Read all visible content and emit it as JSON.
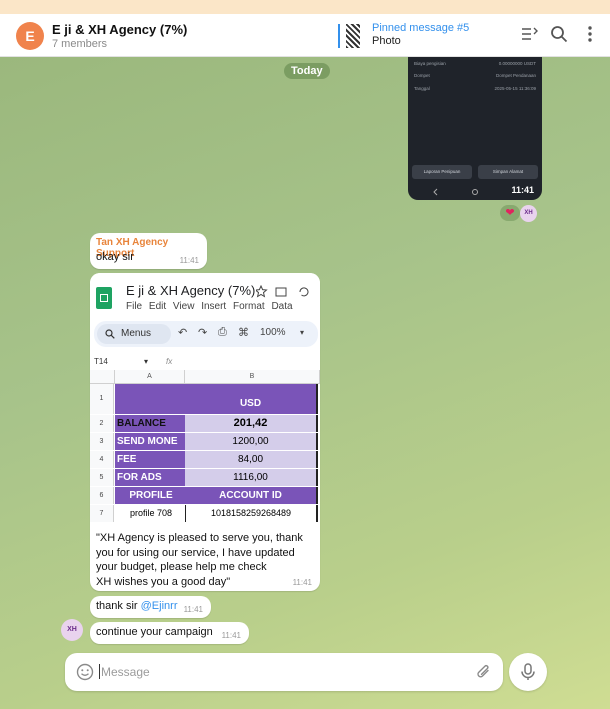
{
  "header": {
    "avatar_letter": "E",
    "title": "E ji & XH Agency (7%)",
    "members": "7 members",
    "pinned_title": "Pinned message #5",
    "pinned_subtitle": "Photo"
  },
  "chat": {
    "date_badge": "Today",
    "phone_screenshot": {
      "rows": [
        {
          "label": "Biaya pengisian",
          "value": "0.00000000 USDT"
        },
        {
          "label": "Dompet",
          "value": "Dompet Pendanaan"
        },
        {
          "label": "Tanggal",
          "value": "2025-05-15 11:36:09"
        }
      ],
      "button_left": "Laporan Penipuan",
      "button_right": "Simpan Alamat",
      "time": "11:41"
    },
    "reaction": "❤",
    "reaction_avatar": "XH",
    "msg1": {
      "sender": "Tan XH Agency Support",
      "text": "okay sir",
      "time": "11:41"
    },
    "photo_msg": {
      "sheet_title": "E ji & XH Agency (7%)",
      "menu": [
        "File",
        "Edit",
        "View",
        "Insert",
        "Format",
        "Data"
      ],
      "search_label": "Menus",
      "zoom": "100%",
      "cell_ref": "T14",
      "fx": "fx",
      "col_a": "A",
      "col_b": "B",
      "rows": [
        {
          "num": "1",
          "a": "",
          "b": "USD"
        },
        {
          "num": "2",
          "a": "BALANCE",
          "b": "201,42"
        },
        {
          "num": "3",
          "a": "SEND MONE",
          "b": "1200,00"
        },
        {
          "num": "4",
          "a": "FEE",
          "b": "84,00"
        },
        {
          "num": "5",
          "a": "FOR ADS",
          "b": "1116,00"
        },
        {
          "num": "6",
          "a": "PROFILE",
          "b": "ACCOUNT ID"
        },
        {
          "num": "7",
          "a": "profile 708",
          "b": "1018158259268489"
        }
      ],
      "caption": "\"XH Agency is pleased to serve you, thank you for using our service, I have updated your budget, please help me check\nXH wishes you a good day\"",
      "time": "11:41"
    },
    "msg3": {
      "text_prefix": "thank sir ",
      "mention": "@Ejinrr",
      "time": "11:41"
    },
    "msg4": {
      "text": "continue your campaign",
      "time": "11:41"
    },
    "left_avatar": "XH"
  },
  "composer": {
    "placeholder": "Message"
  },
  "colors": {
    "accent": "#3390ec",
    "sheet_purple": "#7a54b8",
    "sheet_lavender": "#d4cdea",
    "sender": "#e8843b"
  }
}
